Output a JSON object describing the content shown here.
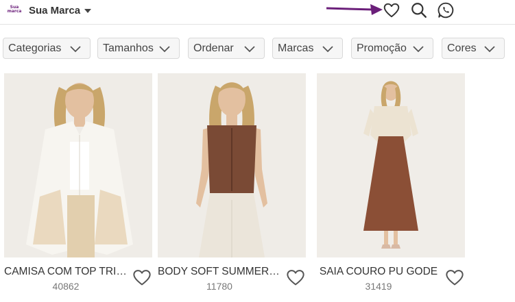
{
  "header": {
    "logo_text": "Sua marca",
    "brand_name": "Sua Marca",
    "icons": {
      "favorites": "heart-icon",
      "search": "search-icon",
      "whatsapp": "whatsapp-icon"
    },
    "annotation_color": "#6b1f7a"
  },
  "filters": [
    {
      "label": "Categorias"
    },
    {
      "label": "Tamanhos"
    },
    {
      "label": "Ordenar"
    },
    {
      "label": "Marcas"
    },
    {
      "label": "Promoção"
    },
    {
      "label": "Cores"
    }
  ],
  "products": [
    {
      "name": "CAMISA COM TOP TRICOT",
      "code": "40862",
      "image": "woman-white-shirt"
    },
    {
      "name": "BODY SOFT SUMMER PREGAS",
      "code": "11780",
      "image": "woman-brown-body"
    },
    {
      "name": "SAIA COURO PU GODE",
      "code": "31419",
      "image": "woman-leather-skirt"
    }
  ],
  "colors": {
    "accent": "#6b1f7a",
    "text": "#333333",
    "filter_bg": "#f6f6f6"
  }
}
